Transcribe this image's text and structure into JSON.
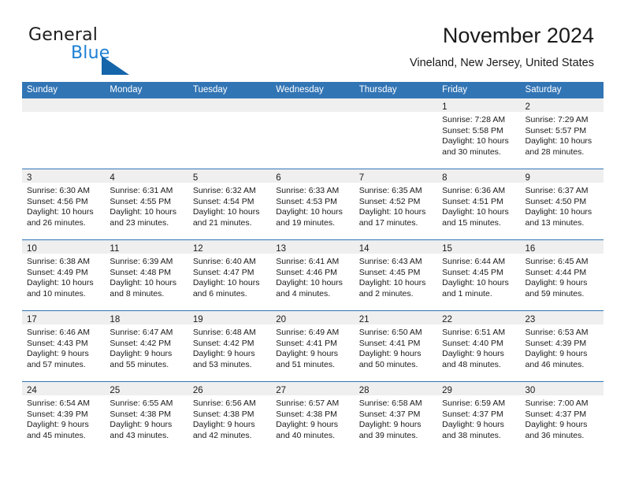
{
  "brand": {
    "word1": "General",
    "word2": "Blue",
    "flag_icon": "blue-triangle-flag-icon",
    "color_dark": "#1d1d1d",
    "color_blue": "#1d7fd4"
  },
  "header": {
    "title": "November 2024",
    "subtitle": "Vineland, New Jersey, United States"
  },
  "theme": {
    "header_blue": "#3275b5",
    "day_band_gray": "#efefef",
    "row_rule": "#3275b5"
  },
  "calendar": {
    "weekdays": [
      "Sunday",
      "Monday",
      "Tuesday",
      "Wednesday",
      "Thursday",
      "Friday",
      "Saturday"
    ],
    "weeks": [
      [
        {
          "day": "",
          "empty": true
        },
        {
          "day": "",
          "empty": true
        },
        {
          "day": "",
          "empty": true
        },
        {
          "day": "",
          "empty": true
        },
        {
          "day": "",
          "empty": true
        },
        {
          "day": "1",
          "sunrise": "Sunrise: 7:28 AM",
          "sunset": "Sunset: 5:58 PM",
          "daylight1": "Daylight: 10 hours",
          "daylight2": "and 30 minutes."
        },
        {
          "day": "2",
          "sunrise": "Sunrise: 7:29 AM",
          "sunset": "Sunset: 5:57 PM",
          "daylight1": "Daylight: 10 hours",
          "daylight2": "and 28 minutes."
        }
      ],
      [
        {
          "day": "3",
          "sunrise": "Sunrise: 6:30 AM",
          "sunset": "Sunset: 4:56 PM",
          "daylight1": "Daylight: 10 hours",
          "daylight2": "and 26 minutes."
        },
        {
          "day": "4",
          "sunrise": "Sunrise: 6:31 AM",
          "sunset": "Sunset: 4:55 PM",
          "daylight1": "Daylight: 10 hours",
          "daylight2": "and 23 minutes."
        },
        {
          "day": "5",
          "sunrise": "Sunrise: 6:32 AM",
          "sunset": "Sunset: 4:54 PM",
          "daylight1": "Daylight: 10 hours",
          "daylight2": "and 21 minutes."
        },
        {
          "day": "6",
          "sunrise": "Sunrise: 6:33 AM",
          "sunset": "Sunset: 4:53 PM",
          "daylight1": "Daylight: 10 hours",
          "daylight2": "and 19 minutes."
        },
        {
          "day": "7",
          "sunrise": "Sunrise: 6:35 AM",
          "sunset": "Sunset: 4:52 PM",
          "daylight1": "Daylight: 10 hours",
          "daylight2": "and 17 minutes."
        },
        {
          "day": "8",
          "sunrise": "Sunrise: 6:36 AM",
          "sunset": "Sunset: 4:51 PM",
          "daylight1": "Daylight: 10 hours",
          "daylight2": "and 15 minutes."
        },
        {
          "day": "9",
          "sunrise": "Sunrise: 6:37 AM",
          "sunset": "Sunset: 4:50 PM",
          "daylight1": "Daylight: 10 hours",
          "daylight2": "and 13 minutes."
        }
      ],
      [
        {
          "day": "10",
          "sunrise": "Sunrise: 6:38 AM",
          "sunset": "Sunset: 4:49 PM",
          "daylight1": "Daylight: 10 hours",
          "daylight2": "and 10 minutes."
        },
        {
          "day": "11",
          "sunrise": "Sunrise: 6:39 AM",
          "sunset": "Sunset: 4:48 PM",
          "daylight1": "Daylight: 10 hours",
          "daylight2": "and 8 minutes."
        },
        {
          "day": "12",
          "sunrise": "Sunrise: 6:40 AM",
          "sunset": "Sunset: 4:47 PM",
          "daylight1": "Daylight: 10 hours",
          "daylight2": "and 6 minutes."
        },
        {
          "day": "13",
          "sunrise": "Sunrise: 6:41 AM",
          "sunset": "Sunset: 4:46 PM",
          "daylight1": "Daylight: 10 hours",
          "daylight2": "and 4 minutes."
        },
        {
          "day": "14",
          "sunrise": "Sunrise: 6:43 AM",
          "sunset": "Sunset: 4:45 PM",
          "daylight1": "Daylight: 10 hours",
          "daylight2": "and 2 minutes."
        },
        {
          "day": "15",
          "sunrise": "Sunrise: 6:44 AM",
          "sunset": "Sunset: 4:45 PM",
          "daylight1": "Daylight: 10 hours",
          "daylight2": "and 1 minute."
        },
        {
          "day": "16",
          "sunrise": "Sunrise: 6:45 AM",
          "sunset": "Sunset: 4:44 PM",
          "daylight1": "Daylight: 9 hours",
          "daylight2": "and 59 minutes."
        }
      ],
      [
        {
          "day": "17",
          "sunrise": "Sunrise: 6:46 AM",
          "sunset": "Sunset: 4:43 PM",
          "daylight1": "Daylight: 9 hours",
          "daylight2": "and 57 minutes."
        },
        {
          "day": "18",
          "sunrise": "Sunrise: 6:47 AM",
          "sunset": "Sunset: 4:42 PM",
          "daylight1": "Daylight: 9 hours",
          "daylight2": "and 55 minutes."
        },
        {
          "day": "19",
          "sunrise": "Sunrise: 6:48 AM",
          "sunset": "Sunset: 4:42 PM",
          "daylight1": "Daylight: 9 hours",
          "daylight2": "and 53 minutes."
        },
        {
          "day": "20",
          "sunrise": "Sunrise: 6:49 AM",
          "sunset": "Sunset: 4:41 PM",
          "daylight1": "Daylight: 9 hours",
          "daylight2": "and 51 minutes."
        },
        {
          "day": "21",
          "sunrise": "Sunrise: 6:50 AM",
          "sunset": "Sunset: 4:41 PM",
          "daylight1": "Daylight: 9 hours",
          "daylight2": "and 50 minutes."
        },
        {
          "day": "22",
          "sunrise": "Sunrise: 6:51 AM",
          "sunset": "Sunset: 4:40 PM",
          "daylight1": "Daylight: 9 hours",
          "daylight2": "and 48 minutes."
        },
        {
          "day": "23",
          "sunrise": "Sunrise: 6:53 AM",
          "sunset": "Sunset: 4:39 PM",
          "daylight1": "Daylight: 9 hours",
          "daylight2": "and 46 minutes."
        }
      ],
      [
        {
          "day": "24",
          "sunrise": "Sunrise: 6:54 AM",
          "sunset": "Sunset: 4:39 PM",
          "daylight1": "Daylight: 9 hours",
          "daylight2": "and 45 minutes."
        },
        {
          "day": "25",
          "sunrise": "Sunrise: 6:55 AM",
          "sunset": "Sunset: 4:38 PM",
          "daylight1": "Daylight: 9 hours",
          "daylight2": "and 43 minutes."
        },
        {
          "day": "26",
          "sunrise": "Sunrise: 6:56 AM",
          "sunset": "Sunset: 4:38 PM",
          "daylight1": "Daylight: 9 hours",
          "daylight2": "and 42 minutes."
        },
        {
          "day": "27",
          "sunrise": "Sunrise: 6:57 AM",
          "sunset": "Sunset: 4:38 PM",
          "daylight1": "Daylight: 9 hours",
          "daylight2": "and 40 minutes."
        },
        {
          "day": "28",
          "sunrise": "Sunrise: 6:58 AM",
          "sunset": "Sunset: 4:37 PM",
          "daylight1": "Daylight: 9 hours",
          "daylight2": "and 39 minutes."
        },
        {
          "day": "29",
          "sunrise": "Sunrise: 6:59 AM",
          "sunset": "Sunset: 4:37 PM",
          "daylight1": "Daylight: 9 hours",
          "daylight2": "and 38 minutes."
        },
        {
          "day": "30",
          "sunrise": "Sunrise: 7:00 AM",
          "sunset": "Sunset: 4:37 PM",
          "daylight1": "Daylight: 9 hours",
          "daylight2": "and 36 minutes."
        }
      ]
    ]
  }
}
